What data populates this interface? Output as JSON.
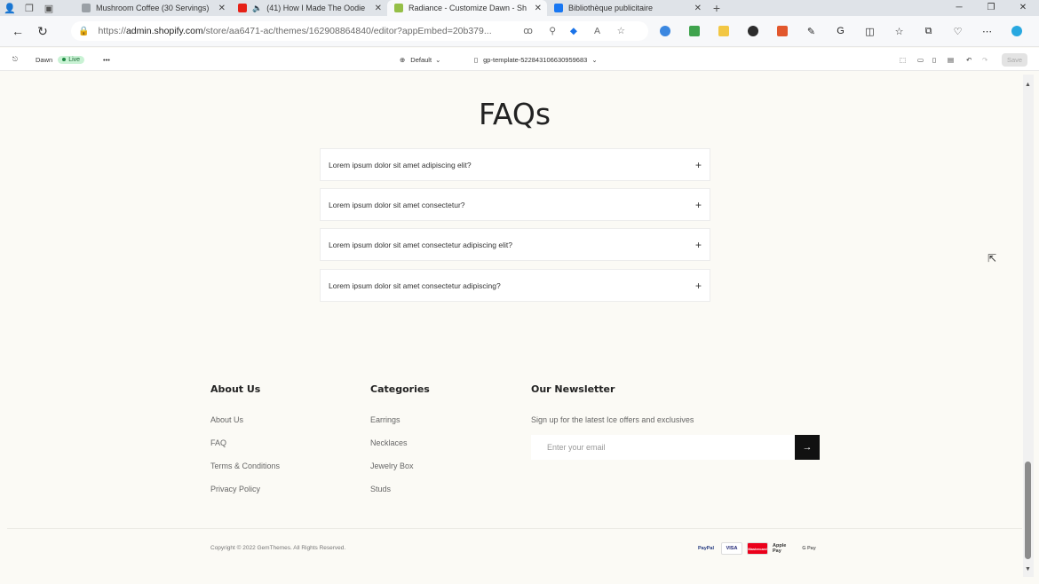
{
  "browser": {
    "tabs": [
      {
        "label": "Mushroom Coffee (30 Servings)",
        "color": "#9aa0a6"
      },
      {
        "label": "(41) How I Made The Oodie",
        "color": "#e62117"
      },
      {
        "label": "Radiance - Customize Dawn - Sh",
        "color": "#95bf47"
      },
      {
        "label": "Bibliothèque publicitaire",
        "color": "#1877f2"
      }
    ],
    "url_prefix": "https://",
    "url_domain": "admin.shopify.com",
    "url_rest": "/store/aa6471-ac/themes/162908864840/editor?appEmbed=20b379..."
  },
  "editor": {
    "theme_name": "Dawn",
    "live_label": "Live",
    "more_label": "•••",
    "default_label": "Default",
    "template_label": "gp-template-522843106630959683",
    "save_label": "Save"
  },
  "faq": {
    "title": "FAQs",
    "items": [
      "Lorem ipsum dolor sit amet adipiscing elit?",
      "Lorem ipsum dolor sit amet consectetur?",
      "Lorem ipsum dolor sit amet consectetur adipiscing elit?",
      "Lorem ipsum dolor sit amet consectetur adipiscing?"
    ]
  },
  "footer": {
    "about": {
      "title": "About Us",
      "links": [
        "About Us",
        "FAQ",
        "Terms & Conditions",
        "Privacy Policy"
      ]
    },
    "categories": {
      "title": "Categories",
      "links": [
        "Earrings",
        "Necklaces",
        "Jewelry Box",
        "Studs"
      ]
    },
    "newsletter": {
      "title": "Our Newsletter",
      "text": "Sign up for the latest Ice offers and exclusives",
      "placeholder": "Enter your email",
      "submit_icon": "arrow-right-icon"
    },
    "copyright": "Copyright © 2022 GemThemes. All Rights Reserved.",
    "payments": [
      "PayPal",
      "VISA",
      "Mastercard",
      "Apple Pay",
      "G Pay"
    ]
  }
}
